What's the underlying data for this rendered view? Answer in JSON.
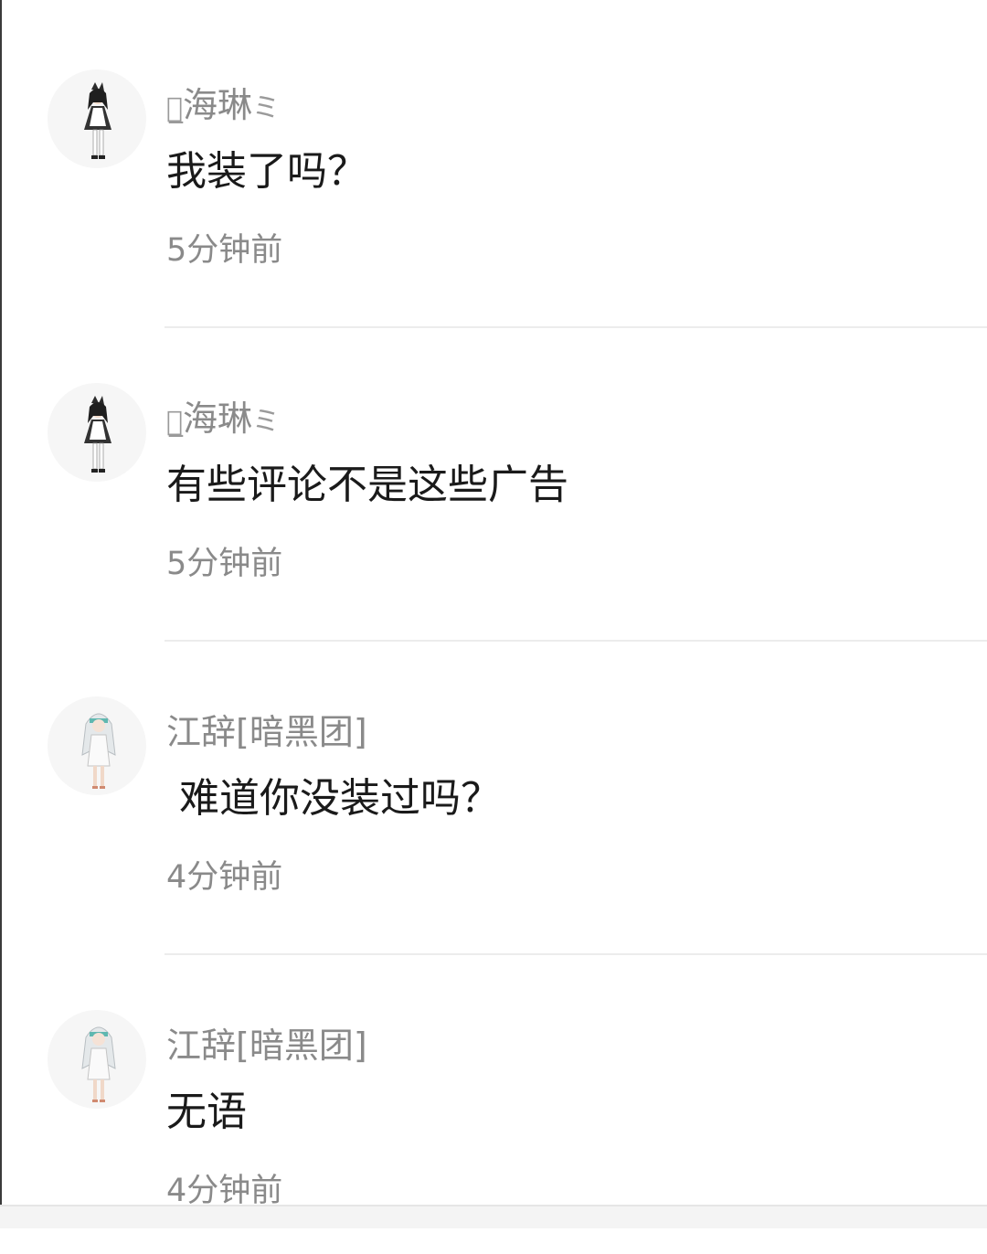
{
  "comments": [
    {
      "user_deco_left": "ฅ̲",
      "username": "海琳",
      "user_deco_right": "ミ",
      "text": "我装了吗？",
      "time": "5分钟前",
      "avatar": "maid-girl-avatar"
    },
    {
      "user_deco_left": "ฅ̲",
      "username": "海琳",
      "user_deco_right": "ミ",
      "text": "有些评论不是这些广告",
      "time": "5分钟前",
      "avatar": "maid-girl-avatar"
    },
    {
      "user_deco_left": "",
      "username": "江辞[暗黑团]",
      "user_deco_right": "",
      "text": " 难道你没装过吗？",
      "time": "4分钟前",
      "avatar": "white-hair-girl-avatar"
    },
    {
      "user_deco_left": "",
      "username": "江辞[暗黑团]",
      "user_deco_right": "",
      "text": "无语",
      "time": "4分钟前",
      "avatar": "white-hair-girl-avatar"
    }
  ],
  "colors": {
    "username": "#8a8a8a",
    "text": "#1a1a1a",
    "time": "#8a8a8a",
    "divider": "#ececec"
  }
}
